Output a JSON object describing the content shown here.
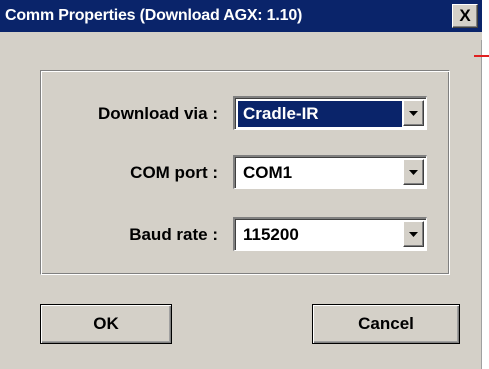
{
  "dialog": {
    "title": "Comm Properties (Download AGX: 1.10)",
    "close_label": "X"
  },
  "fields": {
    "download_via": {
      "label": "Download via :",
      "value": "Cradle-IR"
    },
    "com_port": {
      "label": "COM port :",
      "value": "COM1"
    },
    "baud_rate": {
      "label": "Baud rate :",
      "value": "115200"
    }
  },
  "buttons": {
    "ok_label": "OK",
    "cancel_label": "Cancel"
  },
  "colors": {
    "titlebar": "#0a246a",
    "face": "#d4d0c8",
    "selection": "#0a246a"
  }
}
